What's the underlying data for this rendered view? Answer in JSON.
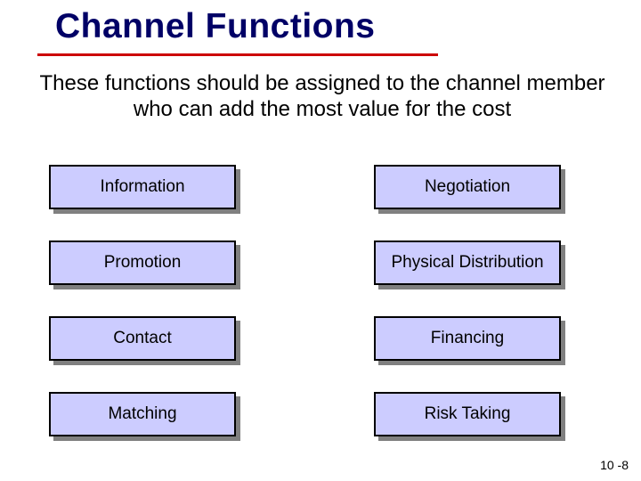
{
  "title": "Channel Functions",
  "subtitle": "These functions should be assigned to the channel member who can add the most value for the cost",
  "functions": {
    "r0c0": "Information",
    "r0c1": "Negotiation",
    "r1c0": "Promotion",
    "r1c1": "Physical Distribution",
    "r2c0": "Contact",
    "r2c1": "Financing",
    "r3c0": "Matching",
    "r3c1": "Risk Taking"
  },
  "page_number": "10 -8"
}
